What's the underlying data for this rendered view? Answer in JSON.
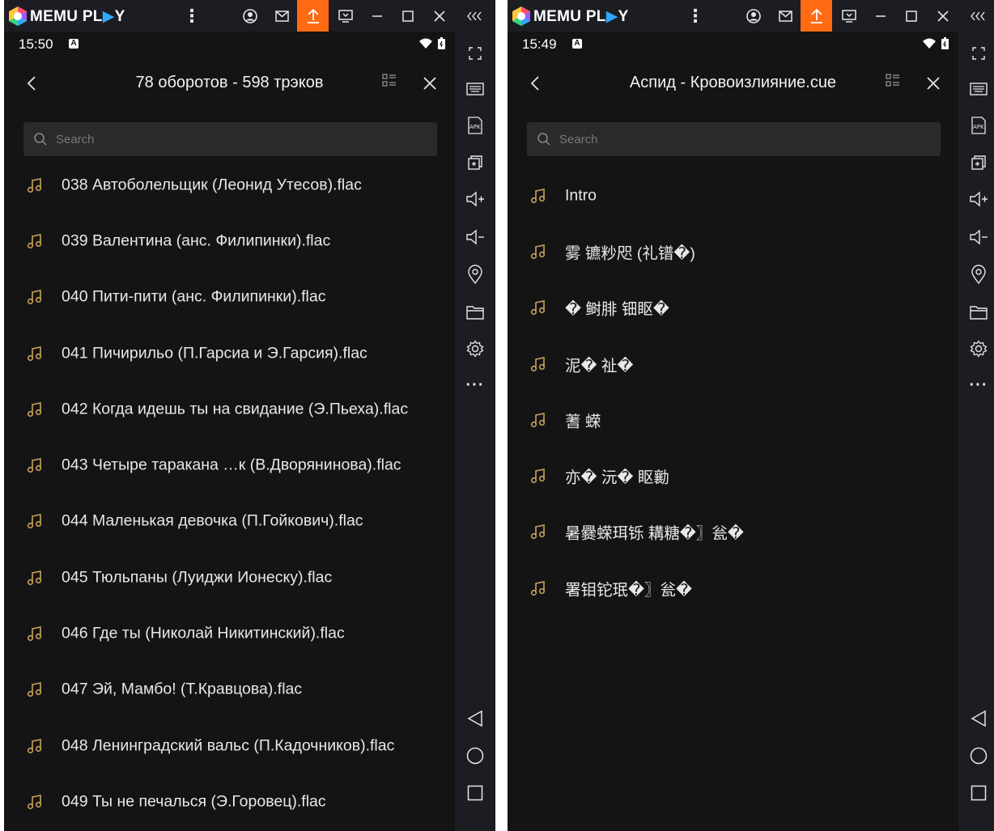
{
  "windows": [
    {
      "app": {
        "logo_text": "MEMU PL",
        "logo_accent": "▶",
        "logo_tail": "Y"
      },
      "status": {
        "time": "15:50"
      },
      "appbar": {
        "title": "78 оборотов - 598 трэков"
      },
      "search": {
        "placeholder": "Search"
      },
      "tracks": [
        "038 Автоболельщик (Леонид Утесов).flac",
        "039 Валентина (анс. Филипинки).flac",
        "040 Пити-пити (анс. Филипинки).flac",
        "041 Пичирильо (П.Гарсиа и Э.Гарсия).flac",
        "042 Когда идешь ты на свидание (Э.Пьеха).flac",
        "043 Четыре таракана …к (В.Дворянинова).flac",
        "044 Маленькая девочка (П.Гойкович).flac",
        "045 Тюльпаны (Луиджи Ионеску).flac",
        "046 Где ты (Николай Никитинский).flac",
        "047 Эй, Мамбо! (Т.Кравцова).flac",
        "048 Ленинградский вальс (П.Кадочников).flac",
        "049 Ты не печалься (Э.Горовец).flac"
      ]
    },
    {
      "app": {
        "logo_text": "MEMU PL",
        "logo_accent": "▶",
        "logo_tail": "Y"
      },
      "status": {
        "time": "15:49"
      },
      "appbar": {
        "title": "Аспид - Кровоизлияние.cue"
      },
      "search": {
        "placeholder": "Search"
      },
      "tracks": [
        "Intro",
        "雾 镳粆咫 (礼镨�)",
        "� 鲥腓 钿眍�",
        "泥� 祉�",
        "蓍 蝾",
        "亦� 沅� 眍勷",
        "暑爨蝾珥铄 耩糖�〗瓮�",
        "署钼铊珉�〗瓮�"
      ]
    }
  ],
  "colors": {
    "accent_upload": "#ff6a13",
    "note_icon": "#c9a35c",
    "titlebar_bg": "#1c1d22",
    "screen_bg": "#141414"
  },
  "icons": {
    "titlebar": [
      "kebab-menu-icon",
      "account-icon",
      "mail-icon",
      "upload-icon",
      "screen-cast-icon",
      "minimize-icon",
      "maximize-icon",
      "close-icon",
      "collapse-sidebar-icon"
    ],
    "sidebar": [
      "fullscreen-icon",
      "keyboard-icon",
      "apk-icon",
      "multi-instance-icon",
      "volume-up-icon",
      "volume-down-icon",
      "location-icon",
      "folder-icon",
      "settings-icon",
      "more-icon",
      "android-back-icon",
      "android-home-icon",
      "android-recents-icon"
    ]
  }
}
